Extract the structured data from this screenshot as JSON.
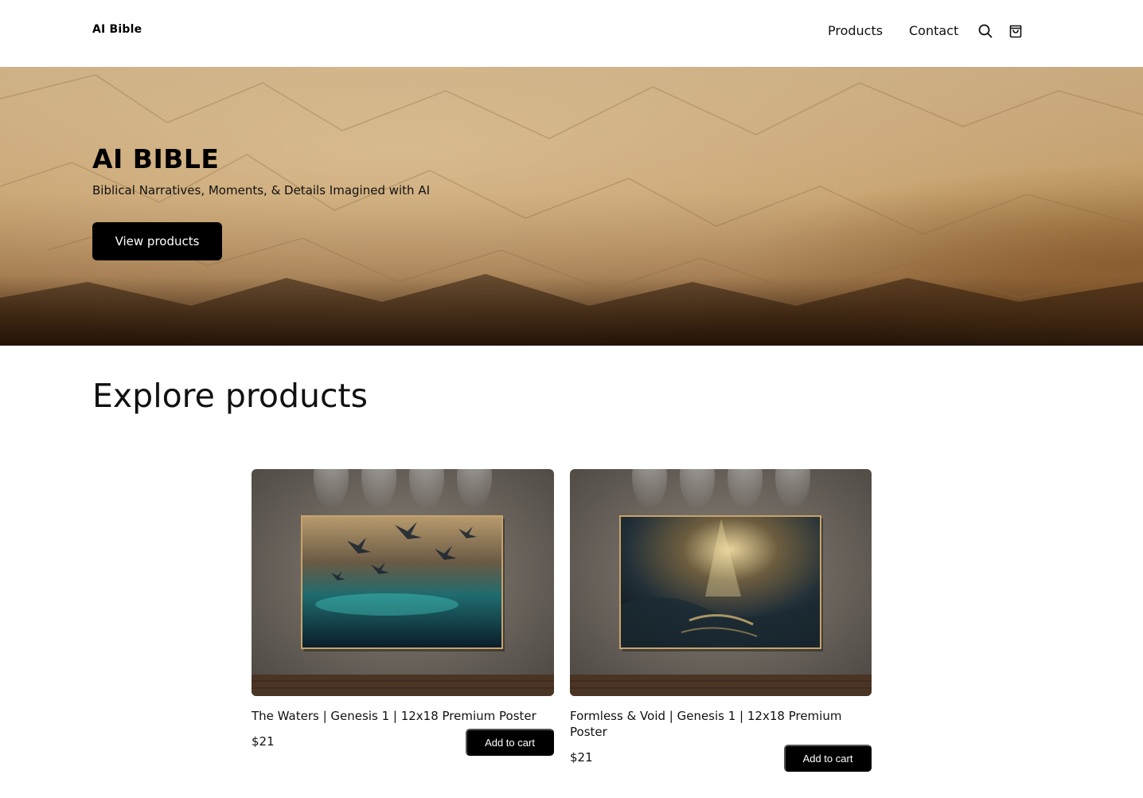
{
  "header": {
    "logo": "AI Bible",
    "nav": [
      {
        "label": "Products"
      },
      {
        "label": "Contact"
      }
    ],
    "icons": [
      "search-icon",
      "shopping-bag-icon"
    ]
  },
  "hero": {
    "title": "AI BIBLE",
    "subtitle": "Biblical Narratives, Moments, & Details Imagined with AI",
    "button_label": "View products"
  },
  "products_section": {
    "title": "Explore products",
    "products": [
      {
        "name": "The Waters | Genesis 1 | 12x18 Premium Poster",
        "price": "$21",
        "cta": "Add to cart"
      },
      {
        "name": "Formless & Void | Genesis 1 | 12x18 Premium Poster",
        "price": "$21",
        "cta": "Add to cart"
      }
    ]
  },
  "colors": {
    "button_bg": "#000000",
    "button_text": "#ffffff",
    "parchment": "#c9a879"
  }
}
